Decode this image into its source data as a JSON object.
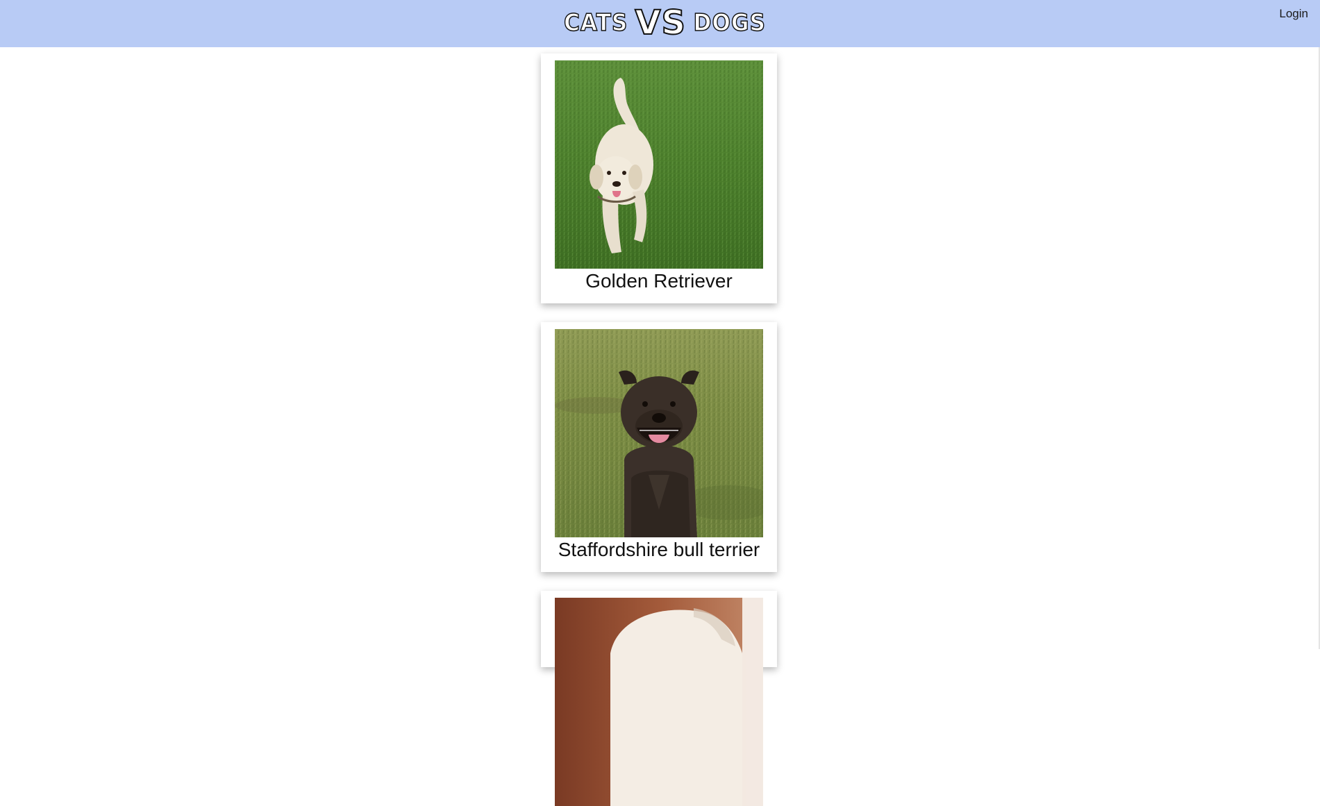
{
  "header": {
    "logo_left": "CATS",
    "logo_vs": "VS",
    "logo_right": "DOGS",
    "login_label": "Login",
    "bg_color": "#b8cbf5"
  },
  "cards": [
    {
      "caption": "Golden Retriever",
      "image": "golden-retriever-photo"
    },
    {
      "caption": "Staffordshire bull terrier",
      "image": "staffordshire-bull-terrier-photo"
    },
    {
      "caption": "",
      "image": "partially-visible-photo"
    }
  ]
}
